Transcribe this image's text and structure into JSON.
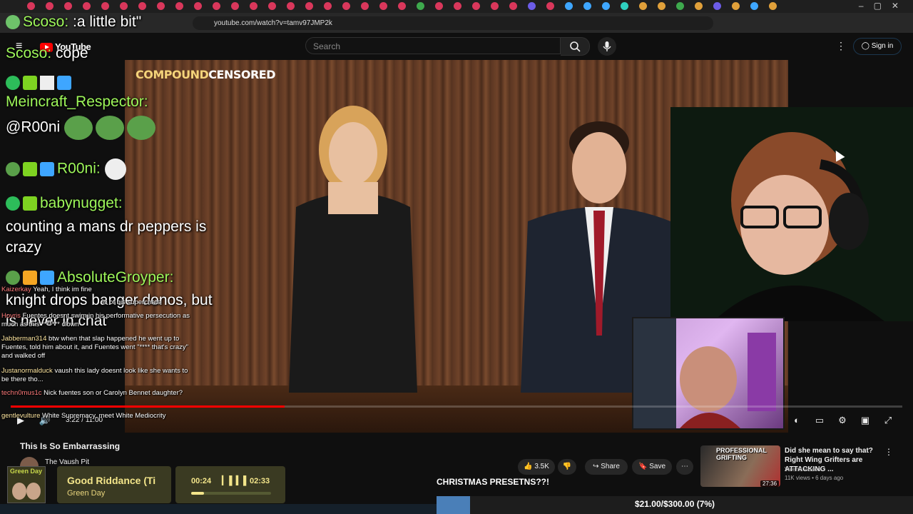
{
  "browser": {
    "url": "youtube.com/watch?v=tamv97JMP2k",
    "tab_colors": [
      "#d9375b",
      "#d9375b",
      "#d9375b",
      "#d9375b",
      "#d9375b",
      "#d9375b",
      "#d9375b",
      "#d9375b",
      "#d9375b",
      "#d9375b",
      "#d9375b",
      "#d9375b",
      "#d9375b",
      "#d9375b",
      "#d9375b",
      "#d9375b",
      "#d9375b",
      "#d9375b",
      "#d9375b",
      "#d9375b",
      "#d9375b",
      "#3ea94d",
      "#d9375b",
      "#d9375b",
      "#d9375b",
      "#d9375b",
      "#d9375b",
      "#6c5ce7",
      "#d9375b",
      "#3ea6ff",
      "#3ea6ff",
      "#3ea6ff",
      "#2fd0c0",
      "#e0a03a",
      "#e0a03a",
      "#3ea94d",
      "#e0a03a",
      "#6c5ce7",
      "#e0a03a",
      "#3ea6ff",
      "#e0a03a"
    ]
  },
  "youtube": {
    "logo_text": "YouTube",
    "search_placeholder": "Search",
    "sign_in": "Sign in"
  },
  "video": {
    "overlay_brand_part1": "COMPOUND",
    "overlay_brand_part2": "CENSORED",
    "time_current": "3:22",
    "time_total": "11:00",
    "progress_fraction": 0.307,
    "title": "This Is So Embarrassing",
    "channel": "The Vaush Pit",
    "likes": "3.5K",
    "share_label": "Share",
    "save_label": "Save"
  },
  "chat_overlay": [
    {
      "user": "Scoso:",
      "message": ":a little bit\""
    },
    {
      "user": "Scoso:",
      "message": "cope"
    },
    {
      "user": "Meincraft_Respector:",
      "message": "@R00ni"
    },
    {
      "user": "R00ni:",
      "message": ""
    },
    {
      "user": "babynugget:",
      "message": "counting a mans dr peppers is"
    },
    {
      "user": "",
      "message": "crazy"
    },
    {
      "user": "AbsoluteGroyper:",
      "message": "knight drops banger donos, but"
    },
    {
      "user": "",
      "message": "is never in chat"
    }
  ],
  "yt_chat": [
    {
      "user": "Kaizerkay",
      "message": "Yeah, I think im fine"
    },
    {
      "user": "",
      "message": "% of his superchats"
    },
    {
      "user": "Hovris",
      "message": "Fuentes doesnt swim in his performative persecution as much as this ******* clown"
    },
    {
      "user": "Jabberman314",
      "message": "btw when that slap happened he went up to Fuentes, told him about it, and Fuentes went \"**** that's crazy\" and walked off"
    },
    {
      "user": "Justanormalduck",
      "message": "vaush this lady doesnt look like she wants to be there tho..."
    },
    {
      "user": "techn0mus1c",
      "message": "Nick fuentes son or Carolyn Bennet daughter?"
    },
    {
      "user": "gentlevulture",
      "message": "White Supremacy, meet White Mediocrity"
    }
  ],
  "recommendation": {
    "thumb_text": "PROFESSIONAL GRIFTING",
    "duration": "27:36",
    "title": "Did she mean to say that? Right Wing Grifters are ATTACKING ...",
    "channel": "Valenti Videos",
    "meta": "11K views • 6 days ago"
  },
  "music": {
    "album_text": "Green Day",
    "song": "Good Riddance (Ti",
    "artist": "Green Day",
    "elapsed": "00:24",
    "duration": "02:33",
    "progress_fraction": 0.157
  },
  "donation": {
    "label": "CHRISTMAS PRESETNS??!",
    "progress_text": "$21.00/$300.00 (7%)",
    "fraction": 0.07
  }
}
